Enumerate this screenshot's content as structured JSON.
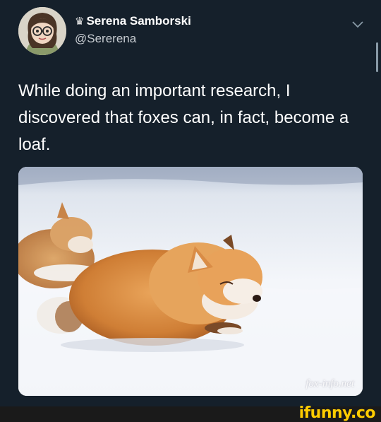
{
  "tweet": {
    "author": {
      "display_name": "Serena Samborski",
      "handle": "@Sererena",
      "name_prefix_icon": "crown-icon"
    },
    "text": "While doing an important research, I discovered that foxes can, in fact, become a loaf.",
    "menu_icon": "chevron-down-icon",
    "media": {
      "watermark": "fox-info.net"
    }
  },
  "footer": {
    "brand": "ifunny.co"
  },
  "colors": {
    "background": "#15202b",
    "text_primary": "#ffffff",
    "text_secondary": "#c7ccd1",
    "brand": "#ffcc00"
  }
}
